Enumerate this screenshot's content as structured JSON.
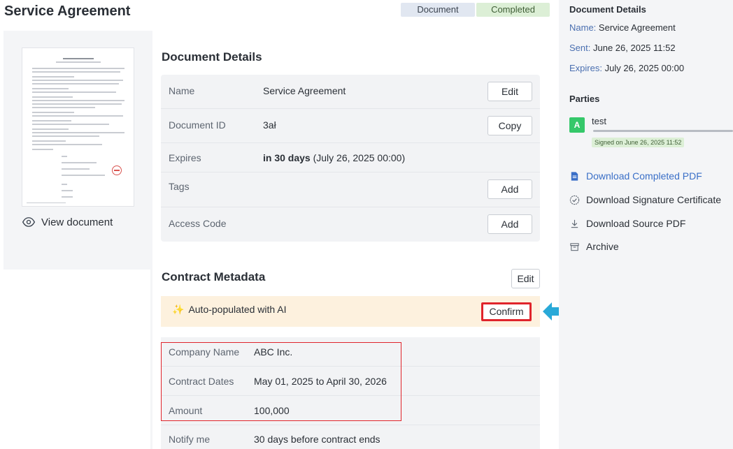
{
  "header": {
    "title": "Service Agreement",
    "badges": {
      "document": "Document",
      "status": "Completed"
    }
  },
  "preview": {
    "view_label": "View document"
  },
  "details": {
    "title": "Document Details",
    "rows": [
      {
        "label": "Name",
        "value": "Service Agreement",
        "button": "Edit"
      },
      {
        "label": "Document ID",
        "value": "3ał",
        "button": "Copy"
      },
      {
        "label": "Expires",
        "value_bold": "in 30 days",
        "value_rest": " (July 26, 2025 00:00)"
      },
      {
        "label": "Tags",
        "button": "Add"
      },
      {
        "label": "Access Code",
        "button": "Add"
      }
    ]
  },
  "metadata": {
    "title": "Contract Metadata",
    "edit_label": "Edit",
    "ai_banner": {
      "icon": "sparkle-icon",
      "text": "Auto-populated with AI",
      "confirm_label": "Confirm"
    },
    "rows": [
      {
        "label": "Company Name",
        "value": "ABC Inc."
      },
      {
        "label": "Contract Dates",
        "value": "May 01, 2025 to April 30, 2026"
      },
      {
        "label": "Amount",
        "value": "100,000"
      },
      {
        "label": "Notify me",
        "value": "30 days before contract ends"
      }
    ]
  },
  "sidebar": {
    "details_heading": "Document Details",
    "name": {
      "key": "Name:",
      "value": "Service Agreement"
    },
    "sent": {
      "key": "Sent:",
      "value": "June 26, 2025 11:52"
    },
    "expires": {
      "key": "Expires:",
      "value": "July 26, 2025 00:00"
    },
    "parties_heading": "Parties",
    "party": {
      "initial": "A",
      "name": "test",
      "signed": "Signed on June 26, 2025 11:52"
    },
    "actions": [
      {
        "label": "Download Completed PDF",
        "icon": "file-icon"
      },
      {
        "label": "Download Signature Certificate",
        "icon": "certificate-icon"
      },
      {
        "label": "Download Source PDF",
        "icon": "download-icon"
      },
      {
        "label": "Archive",
        "icon": "archive-icon"
      }
    ]
  },
  "colors": {
    "accent": "#3a6fc7",
    "highlight": "#e0242b",
    "callout_arrow": "#29a9d8",
    "ai_banner_bg": "#fdf1de",
    "completed_bg": "#dcefd6"
  }
}
